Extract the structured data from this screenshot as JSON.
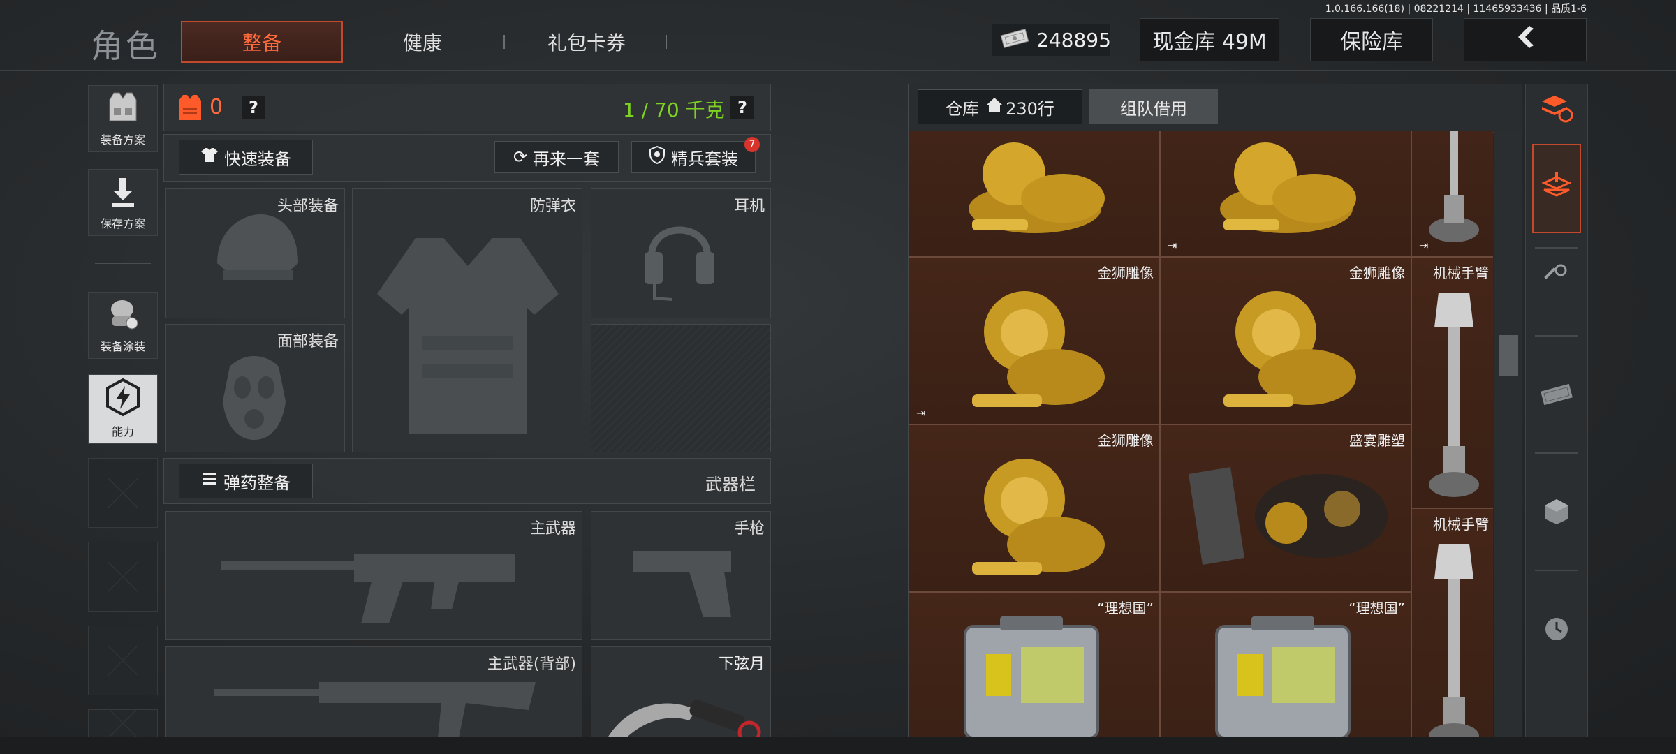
{
  "version": "1.0.166.166(18) | 08221214 | 11465933436 | 品质1-6",
  "header": {
    "title": "角色",
    "tabs": [
      "整备",
      "健康",
      "礼包卡券"
    ],
    "money": "248895",
    "cash_vault": "现金库 49M",
    "safe_box": "保险库"
  },
  "sidebar": {
    "items": [
      {
        "label": "装备方案",
        "icon": "vest-icon"
      },
      {
        "label": "保存方案",
        "icon": "download-icon"
      },
      {
        "label": "装备涂装",
        "icon": "skin-icon"
      },
      {
        "label": "能力",
        "icon": "ability-icon"
      }
    ]
  },
  "equip": {
    "armor_count": "0",
    "weight": "1 / 70 千克",
    "help": "?",
    "quick_equip": "快速装备",
    "retry_set": "再来一套",
    "elite_set": "精兵套装",
    "elite_badge": "7",
    "slots": {
      "head": "头部装备",
      "vest": "防弹衣",
      "headset": "耳机",
      "face": "面部装备"
    },
    "ammo_btn": "弹药整备",
    "weapon_bar": "武器栏",
    "weapons": {
      "primary": "主武器",
      "pistol": "手枪",
      "primary_back": "主武器(背部)",
      "melee": "下弦月"
    }
  },
  "warehouse": {
    "tab_storage": "仓库",
    "tab_rows": "230行",
    "tab_team": "组队借用",
    "items": {
      "lion": "金狮雕像",
      "arm": "机械手臂",
      "feast": "盛宴雕塑",
      "ideal": "“理想国”"
    }
  },
  "colors": {
    "accent": "#ff6a3d",
    "weight_green": "#7ed321",
    "warehouse_bg": "#3d2218"
  }
}
